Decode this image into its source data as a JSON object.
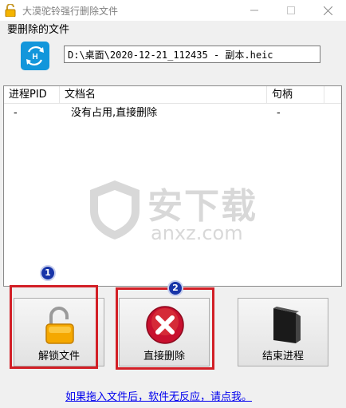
{
  "window": {
    "title": "大漠驼铃强行删除文件",
    "icon": "open-padlock-icon"
  },
  "file_label": "要删除的文件",
  "file_path": "D:\\桌面\\2020-12-21_112435 - 副本.heic",
  "table": {
    "columns": [
      "进程PID",
      "文档名",
      "句柄"
    ],
    "rows": [
      {
        "pid": "-",
        "name": "没有占用,直接删除",
        "handle": "-"
      }
    ]
  },
  "watermark": {
    "text": "安下载",
    "domain": "anxz.com"
  },
  "buttons": {
    "unlock": {
      "label": "解锁文件",
      "icon": "open-padlock-icon"
    },
    "delete": {
      "label": "直接删除",
      "icon": "red-x-icon"
    },
    "kill": {
      "label": "结束进程",
      "icon": "black-folder-icon"
    }
  },
  "annotations": {
    "badge_1": "1",
    "badge_2": "2",
    "highlight_color": "#d21f26",
    "badge_color": "#1734a8"
  },
  "help_link": "如果拖入文件后，软件无反应，请点我。"
}
